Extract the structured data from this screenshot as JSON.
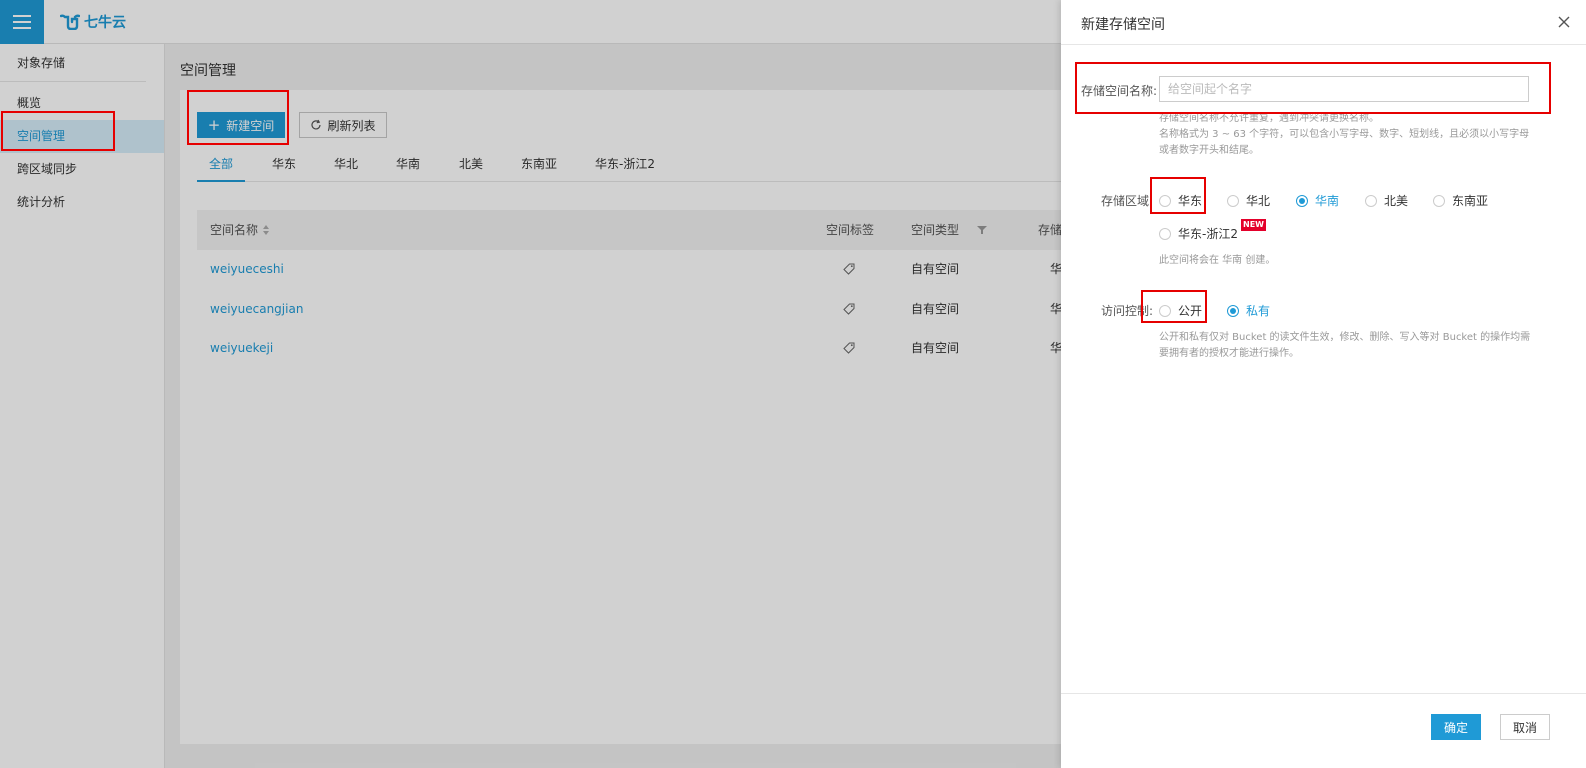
{
  "header": {
    "logo_text": "七牛云"
  },
  "sidebar": {
    "title": "对象存储",
    "items": [
      {
        "label": "概览"
      },
      {
        "label": "空间管理",
        "active": true
      },
      {
        "label": "跨区域同步"
      },
      {
        "label": "统计分析"
      }
    ]
  },
  "main": {
    "page_title": "空间管理",
    "new_button": "新建空间",
    "refresh_button": "刷新列表",
    "tabs": [
      "全部",
      "华东",
      "华北",
      "华南",
      "北美",
      "东南亚",
      "华东-浙江2"
    ],
    "active_tab": "全部",
    "table": {
      "columns": [
        "空间名称",
        "空间标签",
        "空间类型",
        "存储"
      ],
      "rows": [
        {
          "name": "weiyueceshi",
          "type": "自有空间",
          "region": "华"
        },
        {
          "name": "weiyuecangjian",
          "type": "自有空间",
          "region": "华"
        },
        {
          "name": "weiyuekeji",
          "type": "自有空间",
          "region": "华"
        }
      ]
    }
  },
  "drawer": {
    "title": "新建存储空间",
    "name_label": "存储空间名称:",
    "name_placeholder": "给空间起个名字",
    "name_help_1": "存储空间名称不允许重复，遇到冲突请更换名称。",
    "name_help_2": "名称格式为 3 ~ 63 个字符，可以包含小写字母、数字、短划线，且必须以小写字母或者数字开头和结尾。",
    "region_label": "存储区域",
    "regions": [
      "华东",
      "华北",
      "华南",
      "北美",
      "东南亚",
      "华东-浙江2"
    ],
    "selected_region": "华南",
    "new_badge": "NEW",
    "region_help": "此空间将会在 华南 创建。",
    "access_label": "访问控制:",
    "access_options": [
      "公开",
      "私有"
    ],
    "selected_access": "私有",
    "access_help": "公开和私有仅对 Bucket 的读文件生效，修改、删除、写入等对 Bucket 的操作均需要拥有者的授权才能进行操作。",
    "ok_button": "确定",
    "cancel_button": "取消"
  },
  "colors": {
    "accent": "#1f9ad6",
    "highlight": "#e60000",
    "new_badge": "#e4002b"
  }
}
